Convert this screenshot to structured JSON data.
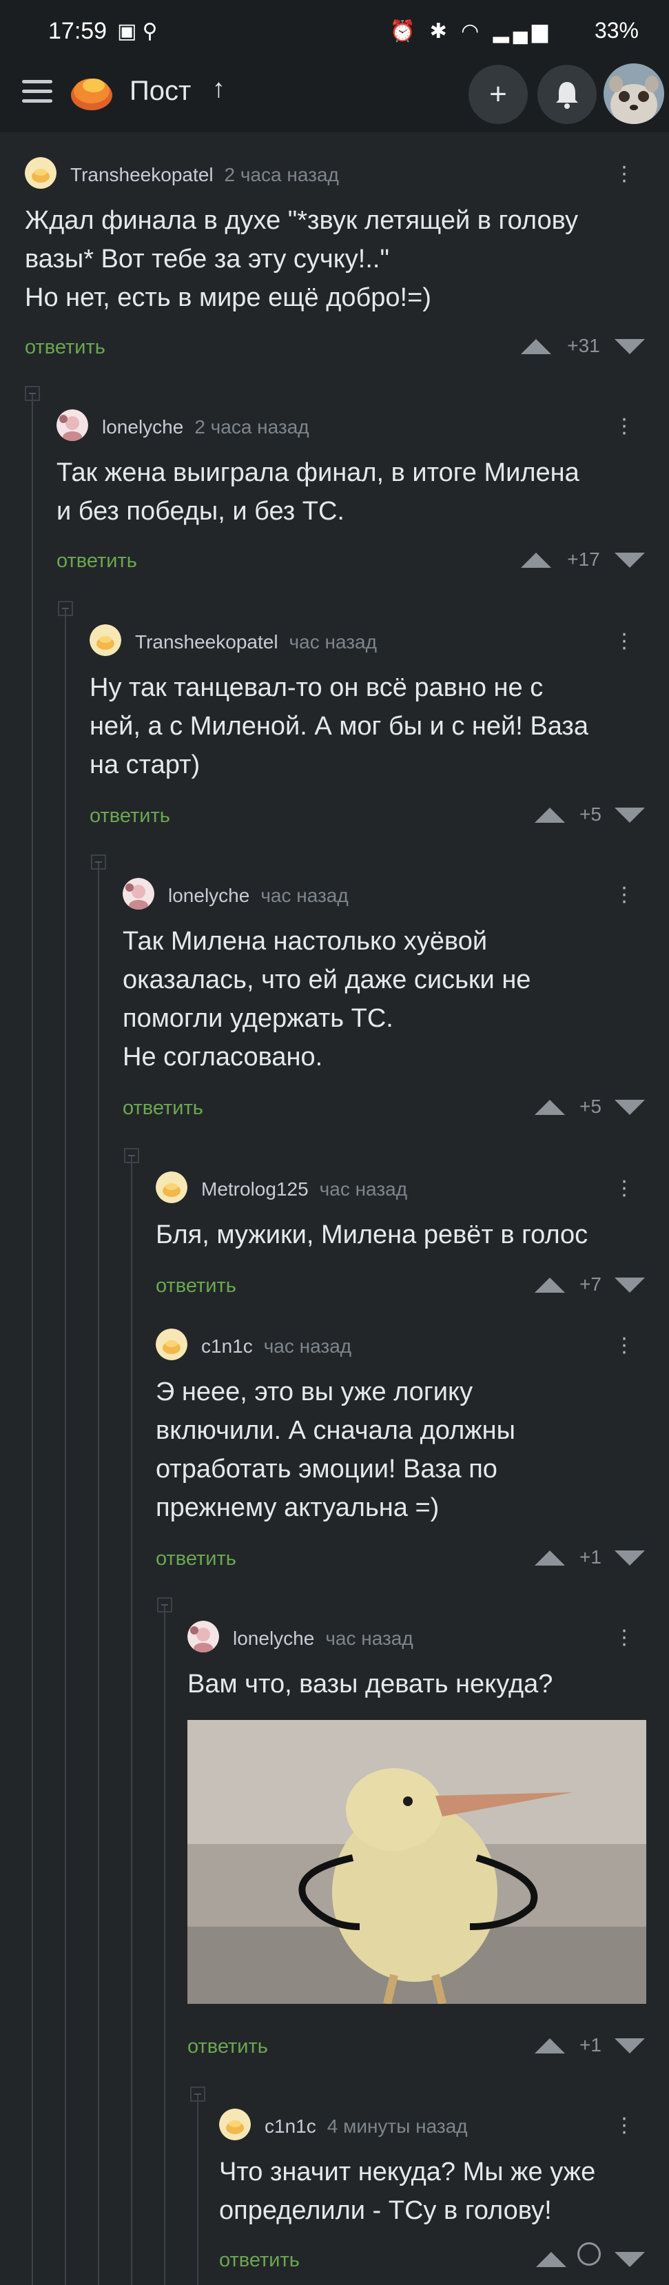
{
  "status": {
    "time": "17:59",
    "battery": "33%"
  },
  "header": {
    "title": "Пост",
    "title_arrow": "↑",
    "add_glyph": "+",
    "bell_glyph": "🔔"
  },
  "comments": [
    {
      "author": "Transheekopatel",
      "time": "2 часа назад",
      "text": "Ждал финала в духе \"*звук летящей в голову\nвазы* Вот тебе за эту сучку!..\"\nНо нет, есть в мире ещё добро!=)",
      "reply": "ответить",
      "score": "+31"
    },
    {
      "author": "lonelyche",
      "time": "2 часа назад",
      "text": "Так жена выиграла финал, в итоге Милена\nи без победы, и без ТС.",
      "reply": "ответить",
      "score": "+17"
    },
    {
      "author": "Transheekopatel",
      "time": "час назад",
      "text": "Ну так танцевал-то он всё равно не с\nней, а с Миленой. А мог бы и с ней! Ваза\nна старт)",
      "reply": "ответить",
      "score": "+5"
    },
    {
      "author": "lonelyche",
      "time": "час назад",
      "text": "Так Милена настолько хуёвой\nоказалась, что ей даже сиськи не\nпомогли удержать ТС.\nНе согласовано.",
      "reply": "ответить",
      "score": "+5"
    },
    {
      "author": "Metrolog125",
      "time": "час назад",
      "text": "Бля, мужики, Милена ревёт в голос",
      "reply": "ответить",
      "score": "+7"
    },
    {
      "author": "c1n1c",
      "time": "час назад",
      "text": "Э неее, это вы уже логику\nвключили. А сначала должны\nотработать эмоции! Ваза по\nпрежнему актуальна =)",
      "reply": "ответить",
      "score": "+1"
    },
    {
      "author": "lonelyche",
      "time": "час назад",
      "text": "Вам что, вазы девать некуда?",
      "reply": "ответить",
      "score": "+1"
    },
    {
      "author": "c1n1c",
      "time": "4 минуты назад",
      "text": "Что значит некуда? Мы же уже\nопределили - ТСу в голову!",
      "reply": "ответить",
      "score": ""
    }
  ]
}
